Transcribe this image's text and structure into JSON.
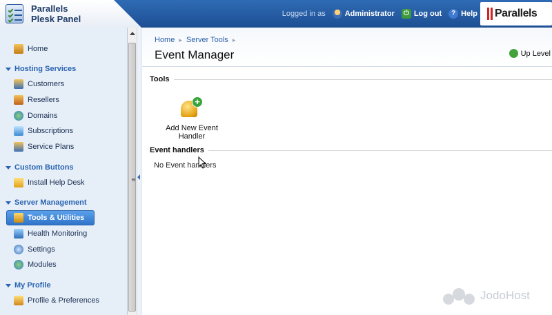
{
  "header": {
    "logo_line1": "Parallels",
    "logo_line2": "Plesk Panel",
    "logged_in_as": "Logged in as",
    "user_name": "Administrator",
    "logout_label": "Log out",
    "help_label": "Help",
    "brand": "Parallels"
  },
  "sidebar": {
    "home": "Home",
    "sections": [
      {
        "title": "Hosting Services",
        "items": [
          "Customers",
          "Resellers",
          "Domains",
          "Subscriptions",
          "Service Plans"
        ]
      },
      {
        "title": "Custom Buttons",
        "items": [
          "Install Help Desk"
        ]
      },
      {
        "title": "Server Management",
        "items": [
          "Tools & Utilities",
          "Health Monitoring",
          "Settings",
          "Modules"
        ]
      },
      {
        "title": "My Profile",
        "items": [
          "Profile & Preferences"
        ]
      }
    ],
    "active_item": "Tools & Utilities"
  },
  "breadcrumb": [
    "Home",
    "Server Tools"
  ],
  "page_title": "Event Manager",
  "up_level": "Up Level",
  "tools_heading": "Tools",
  "tool_add_label": "Add New Event Handler",
  "handlers_heading": "Event handlers",
  "handlers_empty": "No Event handlers",
  "watermark": "JodoHost",
  "colors": {
    "header_blue": "#1d4f93",
    "sidebar_bg": "#e6eef8",
    "section_title": "#2a64b0",
    "active_item": "#2f74c9"
  }
}
